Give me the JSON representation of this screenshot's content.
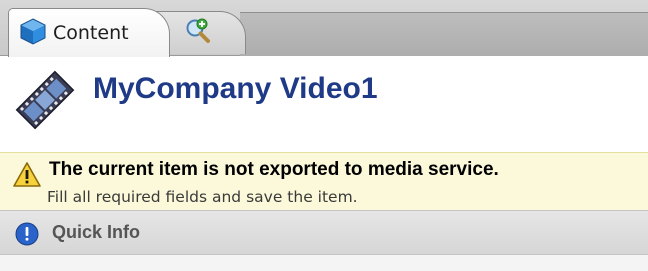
{
  "tabs": [
    {
      "label": "Content",
      "icon": "cube-icon",
      "active": true
    },
    {
      "label": "",
      "icon": "magnify-add-icon",
      "active": false
    }
  ],
  "header": {
    "title": "MyCompany Video1",
    "icon": "film-reel-icon"
  },
  "warning": {
    "title": "The current item is not exported to media service.",
    "message": "Fill all required fields and save the item.",
    "icon": "warning-triangle-icon"
  },
  "section": {
    "title": "Quick Info",
    "icon": "info-icon"
  },
  "colors": {
    "title_blue": "#1f3a86",
    "warning_bg": "#fbf9d9",
    "section_bg": "#dedede"
  }
}
